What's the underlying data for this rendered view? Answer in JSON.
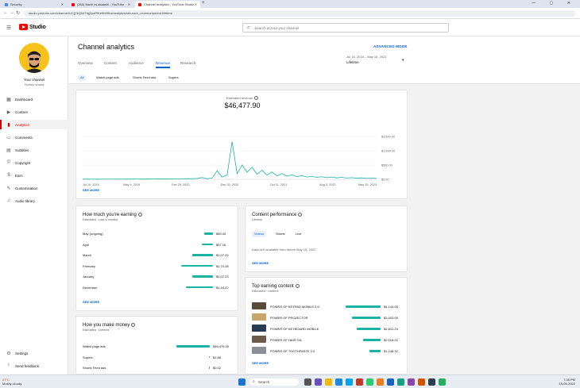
{
  "browser": {
    "tabs": [
      {
        "label": "Security",
        "color": "#4285f4"
      },
      {
        "label": "(260) Itachi vs akaashi - YouTube",
        "color": "#ff0000"
      },
      {
        "label": "Channel analytics - YouTube Studio",
        "color": "#ff0000"
      }
    ],
    "new_tab": "+",
    "window_controls": "— ▢ ✕",
    "url": "studio.youtube.com/channel/UCjj7kQ64Tfqj3yaPfKe9M9Kw/analytics/tab-earn_revenue/period-lifetime"
  },
  "header": {
    "logo_text": "Studio",
    "search_placeholder": "Search across your channel"
  },
  "sidebar": {
    "channel_title": "Your channel",
    "channel_name": "Techno shorts",
    "items": [
      {
        "label": "Dashboard",
        "icon": "▦"
      },
      {
        "label": "Content",
        "icon": "▶"
      },
      {
        "label": "Analytics",
        "icon": "▮"
      },
      {
        "label": "Comments",
        "icon": "▭"
      },
      {
        "label": "Subtitles",
        "icon": "▤"
      },
      {
        "label": "Copyright",
        "icon": "©"
      },
      {
        "label": "Earn",
        "icon": "$"
      },
      {
        "label": "Customisation",
        "icon": "✎"
      },
      {
        "label": "Audio library",
        "icon": "♫"
      }
    ],
    "bottom_items": [
      {
        "label": "Settings",
        "icon": "⚙"
      },
      {
        "label": "Send feedback",
        "icon": "!"
      }
    ]
  },
  "main": {
    "title": "Channel analytics",
    "advanced_mode": "ADVANCED MODE",
    "tabs": [
      "Overview",
      "Content",
      "Audience",
      "Revenue",
      "Research"
    ],
    "date_range": "Jul 16, 2018 – May 15, 2022",
    "date_label": "Lifetime",
    "chips": [
      "All",
      "Watch page ads",
      "Shorts Feed ads",
      "Supers"
    ]
  },
  "revenue_card": {
    "label": "Estimated revenue",
    "value": "$46,477.90",
    "see_more": "SEE MORE"
  },
  "chart_data": {
    "type": "line",
    "title": "Estimated revenue",
    "x_tick_labels": [
      "Jul 16, 2018",
      "May 9, 2019",
      "Feb 29, 2020",
      "Dec 20, 2020",
      "Oct 11, 2021",
      "Aug 3, 2022",
      "May 25, 2023"
    ],
    "y_tick_labels": [
      "$1,500.00",
      "$1,000.00",
      "$500.00",
      "$0.00"
    ],
    "ylim": [
      0,
      1500
    ],
    "series": [
      {
        "values": [
          5,
          5,
          6,
          5,
          6,
          7,
          6,
          8,
          7,
          9,
          8,
          10,
          9,
          12,
          10,
          14,
          12,
          16,
          14,
          18,
          20,
          22,
          25,
          30,
          60,
          20,
          40,
          300,
          80,
          150,
          1320,
          200,
          500,
          250,
          420,
          180,
          320,
          150,
          260,
          120,
          200,
          110,
          160,
          90,
          130,
          80,
          100,
          70,
          90,
          60,
          80,
          50,
          70,
          45,
          60,
          40,
          50,
          35,
          45,
          30
        ]
      }
    ],
    "color": "#1bb3a3"
  },
  "earning_card": {
    "title": "How much you're earning",
    "subtitle": "Estimated · Last 6 months",
    "rows": [
      {
        "label": "May (ongoing)",
        "value": "$40.44",
        "frac": 0.27
      },
      {
        "label": "April",
        "value": "$57.16",
        "frac": 0.33
      },
      {
        "label": "March",
        "value": "$1,07.20",
        "frac": 0.62
      },
      {
        "label": "February",
        "value": "$1,70.28",
        "frac": 0.96
      },
      {
        "label": "January",
        "value": "$1,07.23",
        "frac": 0.62
      },
      {
        "label": "December",
        "value": "$1,44.22",
        "frac": 0.8
      }
    ],
    "see_more": "SEE MORE"
  },
  "money_card": {
    "title": "How you make money",
    "subtitle": "Estimated · Lifetime",
    "rows": [
      {
        "label": "Watch page ads",
        "value": "$46,476.00",
        "frac": 1.0
      },
      {
        "label": "Supers",
        "value": "$1.88",
        "frac": 0.03
      },
      {
        "label": "Shorts Feed ads",
        "value": "$0.02",
        "frac": 0.02
      }
    ]
  },
  "content_perf_card": {
    "title": "Content performance",
    "subtitle": "Lifetime",
    "pills": [
      "Videos",
      "Shorts",
      "Live"
    ],
    "message": "Data isn't available from before May 15, 2022",
    "see_more": "SEE MORE"
  },
  "top_earning_card": {
    "title": "Top earning content",
    "subtitle": "Estimated · Lifetime",
    "rows": [
      {
        "label": "POWER OF KEYPAD MOBILE 2.0",
        "value": "$4,144.05",
        "frac": 1.0,
        "thumb": "#5a4a3a"
      },
      {
        "label": "POWER OF PROJECTOR",
        "value": "$3,403.09",
        "frac": 0.82,
        "thumb": "#c9a56a"
      },
      {
        "label": "POWER OF KEYBOARD MOBILE",
        "value": "$2,841.24",
        "frac": 0.68,
        "thumb": "#2a3a55"
      },
      {
        "label": "POWER OF HAIR OIL",
        "value": "$2,018.22",
        "frac": 0.49,
        "thumb": "#6d5a4c"
      },
      {
        "label": "POWER OF TOOTHPASTE 2.0",
        "value": "$1,248.32",
        "frac": 0.32,
        "thumb": "#8a8f98"
      }
    ],
    "see_more": "SEE MORE"
  },
  "taskbar": {
    "weather_temp": "27°C",
    "weather_desc": "Mostly cloudy",
    "search_placeholder": "Search",
    "time": "7:38 PM",
    "date": "15-05-2022"
  }
}
